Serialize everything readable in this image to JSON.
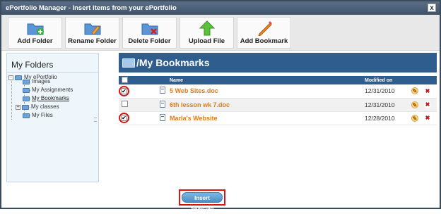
{
  "window": {
    "title": "ePortfolio Manager - Insert items from your ePortfolio",
    "close_glyph": "x"
  },
  "toolbar": {
    "buttons": [
      {
        "label": "Add Folder",
        "icon": "add-folder-icon"
      },
      {
        "label": "Rename Folder",
        "icon": "rename-folder-icon"
      },
      {
        "label": "Delete Folder",
        "icon": "delete-folder-icon"
      },
      {
        "label": "Upload File",
        "icon": "upload-arrow-icon"
      },
      {
        "label": "Add Bookmark",
        "icon": "pencil-bookmark-icon"
      }
    ]
  },
  "sidebar": {
    "header": "My Folders",
    "tree": [
      {
        "label": "My ePortfolio",
        "expander": "-"
      },
      {
        "label": "Images"
      },
      {
        "label": "My Assignments"
      },
      {
        "label": "My Bookmarks",
        "selected": true
      },
      {
        "label": "My classes",
        "expander": "+"
      },
      {
        "label": "My Files"
      }
    ]
  },
  "main": {
    "title": "/My Bookmarks",
    "columns": {
      "name": "Name",
      "modified": "Modified on"
    },
    "rows": [
      {
        "name": "5 Web Sites.doc",
        "modified": "12/31/2010",
        "checked": true,
        "highlighted": true
      },
      {
        "name": "6th lesson wk 7.doc",
        "modified": "12/31/2010",
        "checked": false,
        "highlighted": false
      },
      {
        "name": "Marla's Website",
        "modified": "12/28/2010",
        "checked": true,
        "highlighted": true
      }
    ]
  },
  "footer": {
    "insert_label": "Insert Selected"
  },
  "colors": {
    "accent_blue": "#2f5e8e",
    "link_orange": "#e07b18",
    "highlight_red": "#dd1111"
  }
}
